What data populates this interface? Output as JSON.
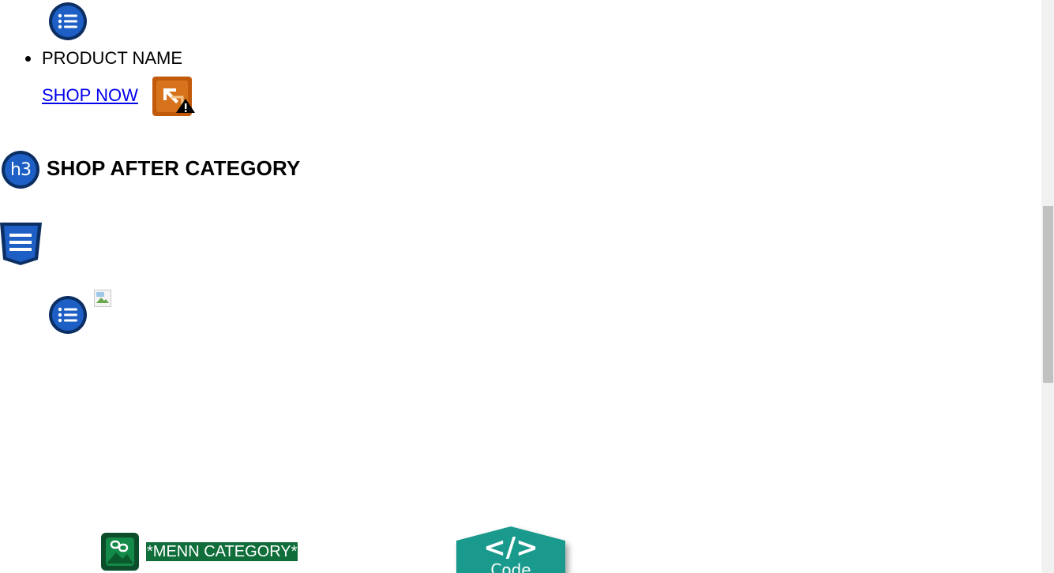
{
  "product": {
    "name": "PRODUCT NAME",
    "shop_link": "SHOP NOW"
  },
  "section": {
    "heading": "SHOP AFTER CATEGORY",
    "heading_badge": "h3"
  },
  "category": {
    "label": "*MENN CATEGORY*"
  },
  "code_badge": {
    "glyph": "</>",
    "label": "Code"
  },
  "icons": {
    "list": "list-icon",
    "external_link_warning": "external-link-warning-icon",
    "heading": "h3-heading-icon",
    "css": "css-icon",
    "broken_image": "broken-image-icon",
    "image_link": "image-link-icon",
    "code": "code-icon"
  },
  "colors": {
    "link": "#0000ee",
    "badge_blue": "#1d5fc4",
    "badge_navy": "#0b2e63",
    "category_green": "#0f6e3a",
    "warning_orange": "#c15a0a",
    "code_teal": "#1a9a8c"
  }
}
